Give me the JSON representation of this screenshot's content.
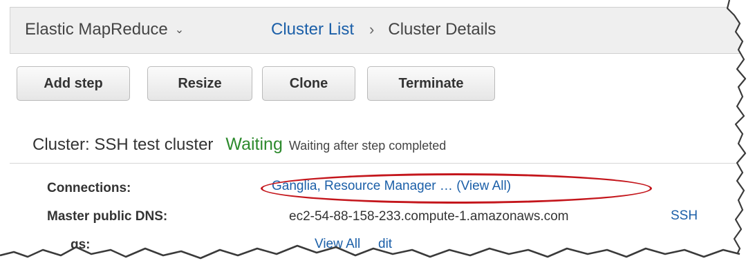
{
  "header": {
    "app_name": "Elastic MapReduce",
    "app_chevron": "⌄",
    "breadcrumb": {
      "link": "Cluster List",
      "separator": "›",
      "current": "Cluster Details"
    }
  },
  "toolbar": {
    "add_step": "Add step",
    "resize": "Resize",
    "clone": "Clone",
    "terminate": "Terminate"
  },
  "cluster": {
    "name": "Cluster: SSH test cluster",
    "status": "Waiting",
    "status_detail": "Waiting after step completed"
  },
  "details": {
    "connections_label": "Connections:",
    "connections_value": "Ganglia, Resource Manager … (View All)",
    "dns_label": "Master public DNS:",
    "dns_value": "ec2-54-88-158-233.compute-1.amazonaws.com",
    "ssh_link": "SSH",
    "tags_label_partial": "gs:",
    "view_all_partial": "View All",
    "edit_partial": "dit"
  },
  "colors": {
    "link": "#1b5fa8",
    "status_green": "#2d8a2d",
    "callout_red": "#c4161c",
    "header_bg": "#efefef"
  }
}
